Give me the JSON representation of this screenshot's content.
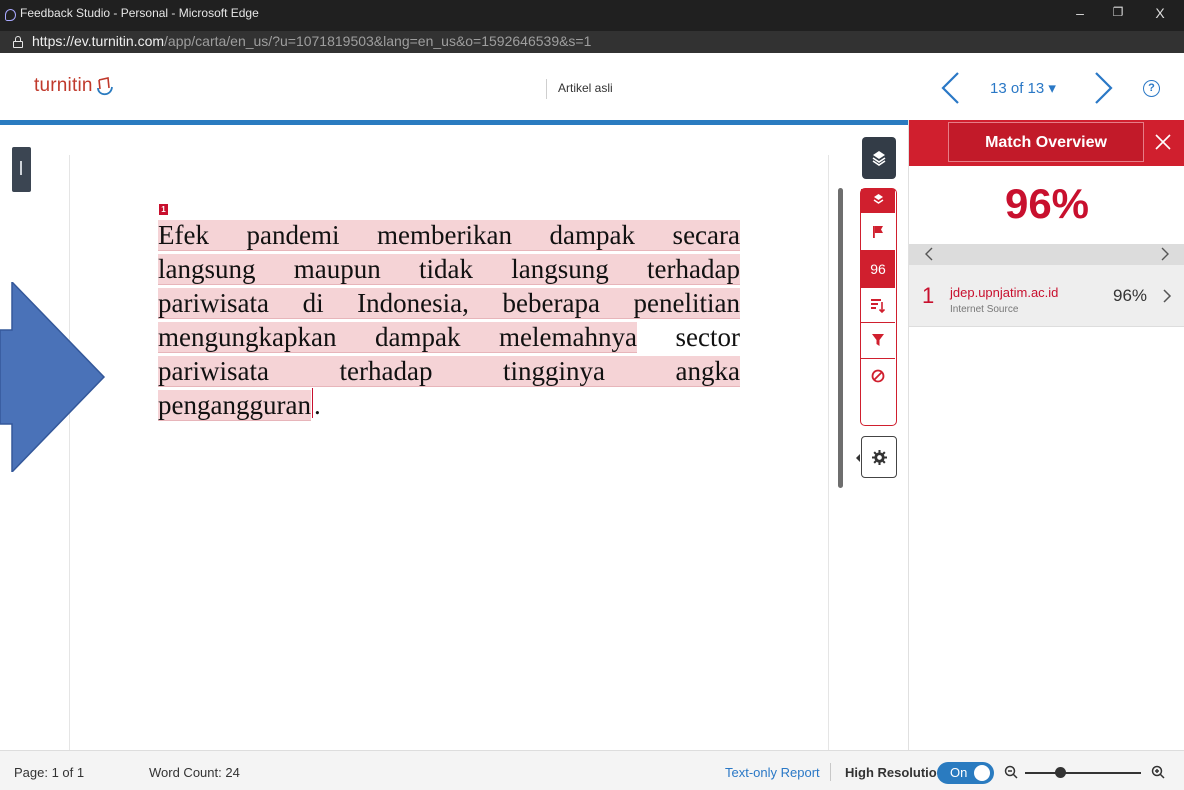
{
  "browser": {
    "window_title": "Feedback Studio - Personal - Microsoft Edge",
    "url_host": "https://ev.turnitin.com",
    "url_path": "/app/carta/en_us/?u=1071819503&lang=en_us&o=1592646539&s=1",
    "controls": {
      "minimize": "–",
      "restore": "❐",
      "close": "X"
    }
  },
  "header": {
    "logo_text": "turnitin",
    "document_title": "Artikel asli",
    "page_selector": "13 of 13 ▾",
    "help_symbol": "?"
  },
  "document": {
    "match_marker": "1",
    "lines": [
      {
        "text": "Efek pandemi memberikan dampak secara",
        "highlighted": true
      },
      {
        "text": "langsung maupun tidak langsung terhadap",
        "highlighted": true
      },
      {
        "text": "pariwisata di Indonesia, beberapa penelitian",
        "highlighted": true
      },
      {
        "highlighted_part": "mengungkapkan dampak melemahnya",
        "plain_part": " sector"
      },
      {
        "text": "pariwisata terhadap tingginya angka",
        "highlighted": true
      },
      {
        "highlighted_part": "pengangguran",
        "plain_part": "."
      }
    ]
  },
  "toolbar": {
    "match_count": "96"
  },
  "match_overview": {
    "title": "Match Overview",
    "percentage": "96%",
    "sources": [
      {
        "number": "1",
        "name": "jdep.upnjatim.ac.id",
        "type": "Internet Source",
        "percent": "96%"
      }
    ]
  },
  "statusbar": {
    "page": "Page: 1 of 1",
    "word_count": "Word Count: 24",
    "text_only_report": "Text-only Report",
    "high_resolution": "High Resolution",
    "toggle_state": "On"
  },
  "colors": {
    "brand_red": "#d01f2e",
    "link_blue": "#2a78c6",
    "highlight": "#f5d3d6",
    "annotation_arrow": "#4a72b8"
  }
}
